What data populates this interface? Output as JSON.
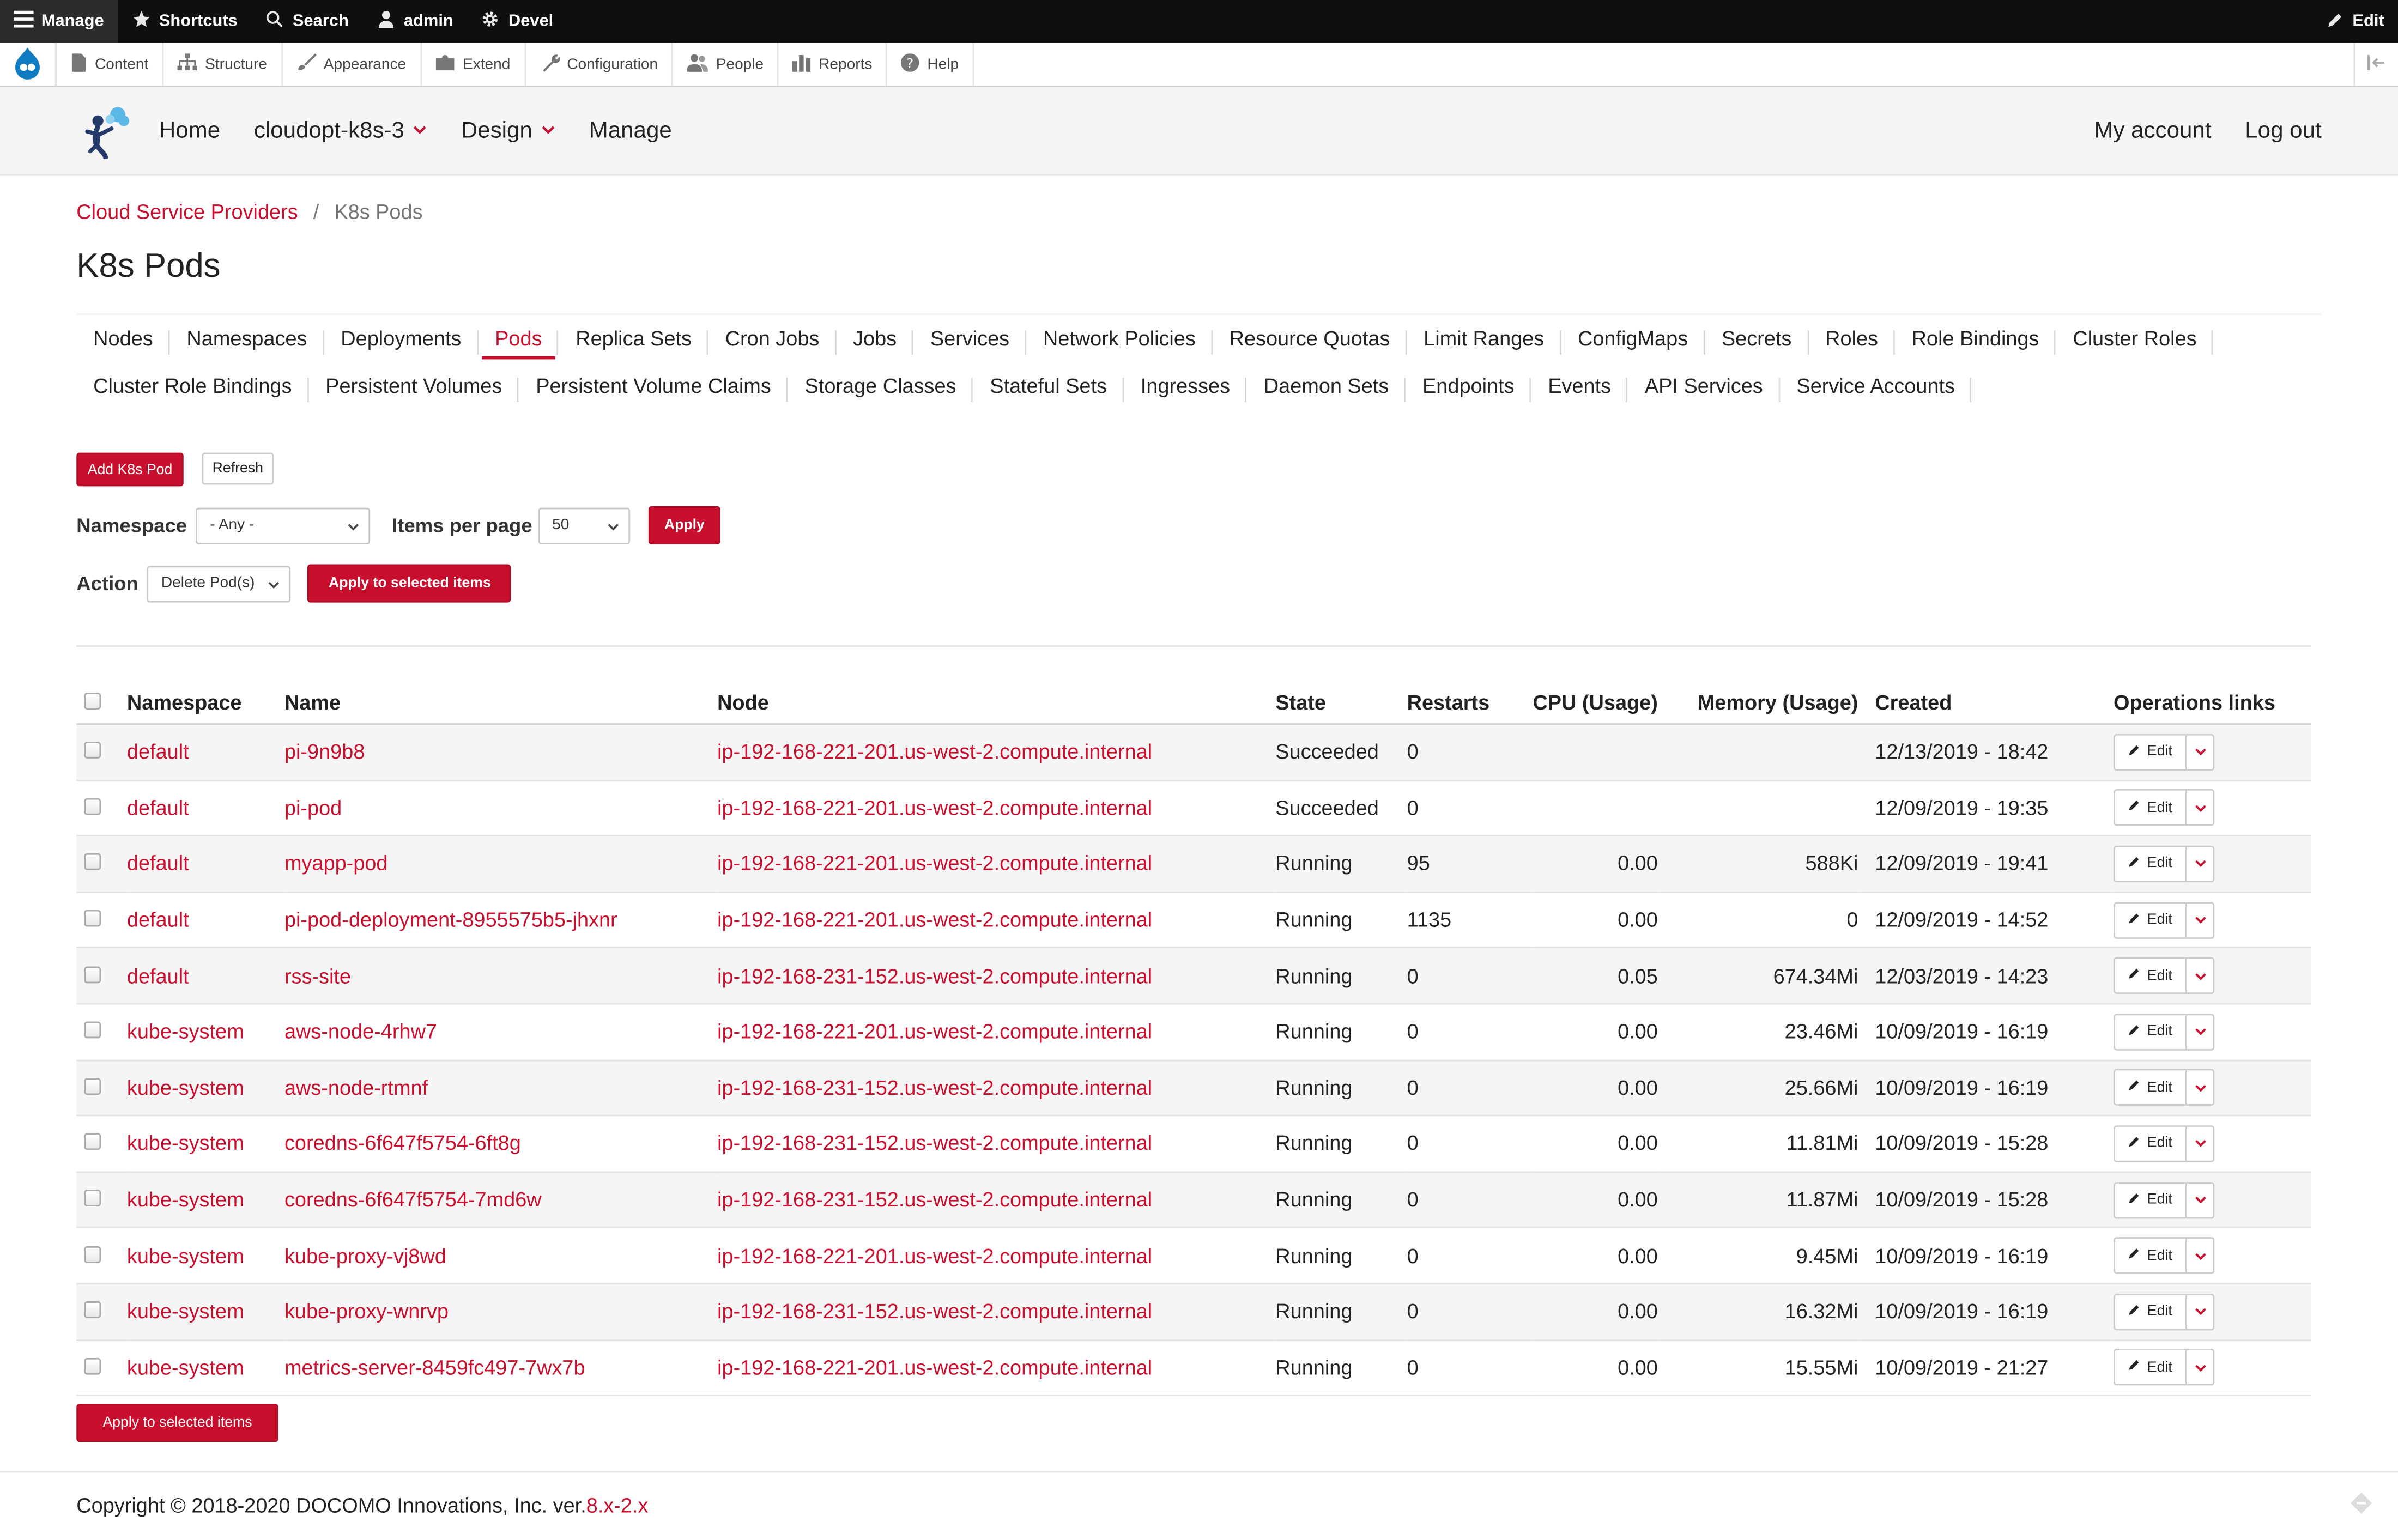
{
  "admin_toolbar": {
    "manage": "Manage",
    "shortcuts": "Shortcuts",
    "search": "Search",
    "user": "admin",
    "devel": "Devel",
    "edit": "Edit"
  },
  "admin_menu": [
    {
      "label": "Content",
      "icon": "file-icon"
    },
    {
      "label": "Structure",
      "icon": "structure-icon"
    },
    {
      "label": "Appearance",
      "icon": "brush-icon"
    },
    {
      "label": "Extend",
      "icon": "puzzle-icon"
    },
    {
      "label": "Configuration",
      "icon": "wrench-icon"
    },
    {
      "label": "People",
      "icon": "people-icon"
    },
    {
      "label": "Reports",
      "icon": "bar-chart-icon"
    },
    {
      "label": "Help",
      "icon": "help-icon"
    }
  ],
  "site_nav": {
    "home": "Home",
    "cloud": "cloudopt-k8s-3",
    "design": "Design",
    "manage": "Manage",
    "my_account": "My account",
    "log_out": "Log out"
  },
  "breadcrumb": {
    "parent": "Cloud Service Providers",
    "separator": "/",
    "current": "K8s Pods"
  },
  "page_title": "K8s Pods",
  "tabs_row1": [
    "Nodes",
    "Namespaces",
    "Deployments",
    "Pods",
    "Replica Sets",
    "Cron Jobs",
    "Jobs",
    "Services",
    "Network Policies",
    "Resource Quotas",
    "Limit Ranges",
    "ConfigMaps",
    "Secrets",
    "Roles",
    "Role Bindings",
    "Cluster Roles"
  ],
  "tabs_row2": [
    "Cluster Role Bindings",
    "Persistent Volumes",
    "Persistent Volume Claims",
    "Storage Classes",
    "Stateful Sets",
    "Ingresses",
    "Daemon Sets",
    "Endpoints",
    "Events",
    "API Services",
    "Service Accounts"
  ],
  "active_tab": "Pods",
  "buttons": {
    "add": "Add K8s Pod",
    "refresh": "Refresh",
    "apply": "Apply",
    "apply_selected": "Apply to selected items"
  },
  "filters": {
    "namespace_label": "Namespace",
    "namespace_value": "- Any -",
    "items_label": "Items per page",
    "items_value": "50",
    "action_label": "Action",
    "action_value": "Delete Pod(s)"
  },
  "table": {
    "headers": [
      "Namespace",
      "Name",
      "Node",
      "State",
      "Restarts",
      "CPU (Usage)",
      "Memory (Usage)",
      "Created",
      "Operations links"
    ],
    "edit_label": "Edit",
    "rows": [
      {
        "namespace": "default",
        "name": "pi-9n9b8",
        "node": "ip-192-168-221-201.us-west-2.compute.internal",
        "state": "Succeeded",
        "restarts": "0",
        "cpu": "",
        "memory": "",
        "created": "12/13/2019 - 18:42"
      },
      {
        "namespace": "default",
        "name": "pi-pod",
        "node": "ip-192-168-221-201.us-west-2.compute.internal",
        "state": "Succeeded",
        "restarts": "0",
        "cpu": "",
        "memory": "",
        "created": "12/09/2019 - 19:35"
      },
      {
        "namespace": "default",
        "name": "myapp-pod",
        "node": "ip-192-168-221-201.us-west-2.compute.internal",
        "state": "Running",
        "restarts": "95",
        "cpu": "0.00",
        "memory": "588Ki",
        "created": "12/09/2019 - 19:41"
      },
      {
        "namespace": "default",
        "name": "pi-pod-deployment-8955575b5-jhxnr",
        "node": "ip-192-168-221-201.us-west-2.compute.internal",
        "state": "Running",
        "restarts": "1135",
        "cpu": "0.00",
        "memory": "0",
        "created": "12/09/2019 - 14:52"
      },
      {
        "namespace": "default",
        "name": "rss-site",
        "node": "ip-192-168-231-152.us-west-2.compute.internal",
        "state": "Running",
        "restarts": "0",
        "cpu": "0.05",
        "memory": "674.34Mi",
        "created": "12/03/2019 - 14:23"
      },
      {
        "namespace": "kube-system",
        "name": "aws-node-4rhw7",
        "node": "ip-192-168-221-201.us-west-2.compute.internal",
        "state": "Running",
        "restarts": "0",
        "cpu": "0.00",
        "memory": "23.46Mi",
        "created": "10/09/2019 - 16:19"
      },
      {
        "namespace": "kube-system",
        "name": "aws-node-rtmnf",
        "node": "ip-192-168-231-152.us-west-2.compute.internal",
        "state": "Running",
        "restarts": "0",
        "cpu": "0.00",
        "memory": "25.66Mi",
        "created": "10/09/2019 - 16:19"
      },
      {
        "namespace": "kube-system",
        "name": "coredns-6f647f5754-6ft8g",
        "node": "ip-192-168-231-152.us-west-2.compute.internal",
        "state": "Running",
        "restarts": "0",
        "cpu": "0.00",
        "memory": "11.81Mi",
        "created": "10/09/2019 - 15:28"
      },
      {
        "namespace": "kube-system",
        "name": "coredns-6f647f5754-7md6w",
        "node": "ip-192-168-231-152.us-west-2.compute.internal",
        "state": "Running",
        "restarts": "0",
        "cpu": "0.00",
        "memory": "11.87Mi",
        "created": "10/09/2019 - 15:28"
      },
      {
        "namespace": "kube-system",
        "name": "kube-proxy-vj8wd",
        "node": "ip-192-168-221-201.us-west-2.compute.internal",
        "state": "Running",
        "restarts": "0",
        "cpu": "0.00",
        "memory": "9.45Mi",
        "created": "10/09/2019 - 16:19"
      },
      {
        "namespace": "kube-system",
        "name": "kube-proxy-wnrvp",
        "node": "ip-192-168-231-152.us-west-2.compute.internal",
        "state": "Running",
        "restarts": "0",
        "cpu": "0.00",
        "memory": "16.32Mi",
        "created": "10/09/2019 - 16:19"
      },
      {
        "namespace": "kube-system",
        "name": "metrics-server-8459fc497-7wx7b",
        "node": "ip-192-168-221-201.us-west-2.compute.internal",
        "state": "Running",
        "restarts": "0",
        "cpu": "0.00",
        "memory": "15.55Mi",
        "created": "10/09/2019 - 21:27"
      }
    ]
  },
  "footer": {
    "text": "Copyright © 2018-2020 DOCOMO Innovations, Inc. ver.",
    "version": "8.x-2.x"
  },
  "colors": {
    "accent": "#c8102e",
    "toolbar": "#0f0f0f"
  }
}
